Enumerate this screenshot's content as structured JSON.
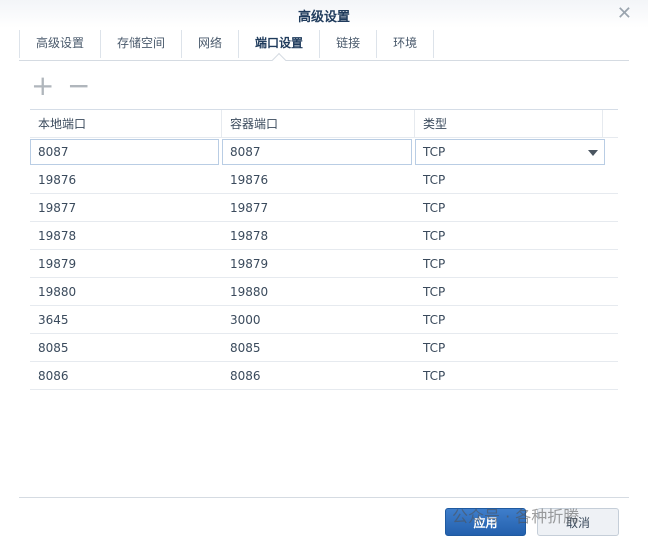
{
  "window": {
    "title": "高级设置",
    "close_icon": "close-icon"
  },
  "tabs": [
    {
      "label": "高级设置"
    },
    {
      "label": "存储空间"
    },
    {
      "label": "网络"
    },
    {
      "label": "端口设置",
      "active": true
    },
    {
      "label": "链接"
    },
    {
      "label": "环境"
    }
  ],
  "toolbar": {
    "add": "+",
    "remove": "−"
  },
  "table": {
    "headers": [
      "本地端口",
      "容器端口",
      "类型"
    ],
    "edit_row": {
      "local": "8087",
      "container": "8087",
      "type": "TCP"
    },
    "rows": [
      [
        "19876",
        "19876",
        "TCP"
      ],
      [
        "19877",
        "19877",
        "TCP"
      ],
      [
        "19878",
        "19878",
        "TCP"
      ],
      [
        "19879",
        "19879",
        "TCP"
      ],
      [
        "19880",
        "19880",
        "TCP"
      ],
      [
        "3645",
        "3000",
        "TCP"
      ],
      [
        "8085",
        "8085",
        "TCP"
      ],
      [
        "8086",
        "8086",
        "TCP"
      ]
    ]
  },
  "footer": {
    "apply": "应用",
    "cancel": "取消"
  },
  "watermark": "公众号 · 各种折腾"
}
